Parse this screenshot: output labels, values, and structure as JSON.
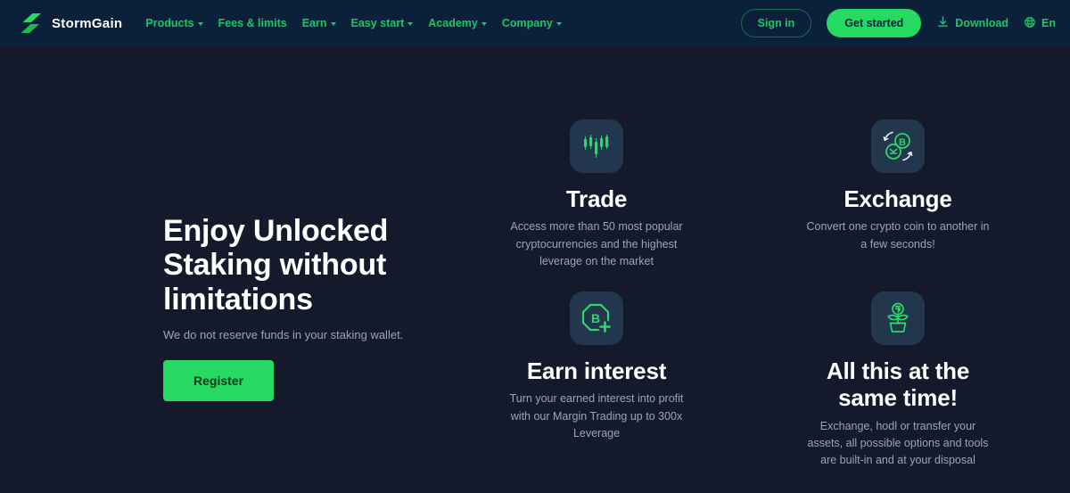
{
  "navbar": {
    "brand": {
      "name": "StormGain",
      "logo_icon": "stormgain-bolt-logo"
    },
    "links": [
      {
        "label": "Products",
        "has_dropdown": true
      },
      {
        "label": "Fees & limits",
        "has_dropdown": false
      },
      {
        "label": "Earn",
        "has_dropdown": true
      },
      {
        "label": "Easy start",
        "has_dropdown": true
      },
      {
        "label": "Academy",
        "has_dropdown": true
      },
      {
        "label": "Company",
        "has_dropdown": true
      }
    ],
    "sign_in_label": "Sign in",
    "get_started_label": "Get started",
    "download_label": "Download",
    "download_icon": "download-icon",
    "language_label": "En",
    "language_icon": "globe-icon"
  },
  "hero": {
    "title": "Enjoy Unlocked Staking without limitations",
    "subtitle": "We do not reserve funds in your staking wallet.",
    "register_label": "Register"
  },
  "features": [
    {
      "icon": "candlestick-chart-icon",
      "title": "Trade",
      "description": "Access more than 50 most popular cryptocurrencies and the highest leverage on the market"
    },
    {
      "icon": "crypto-exchange-icon",
      "title": "Exchange",
      "description": "Convert one crypto coin to another in a few seconds!"
    },
    {
      "icon": "bitcoin-plus-icon",
      "title": "Earn interest",
      "description": "Turn your earned interest into profit with our Margin Trading up to 300x Leverage"
    },
    {
      "icon": "money-plant-icon",
      "title": "All this at the same time!",
      "description": "Exchange, hodl or transfer your assets, all possible options and tools are built-in and at your disposal"
    }
  ],
  "colors": {
    "navbar_bg": "#0b2039",
    "page_bg": "#141a2b",
    "accent_green": "#26d962",
    "link_green": "#17c964",
    "icon_tile_bg": "#22364d",
    "muted_text": "#9aa4b8"
  }
}
